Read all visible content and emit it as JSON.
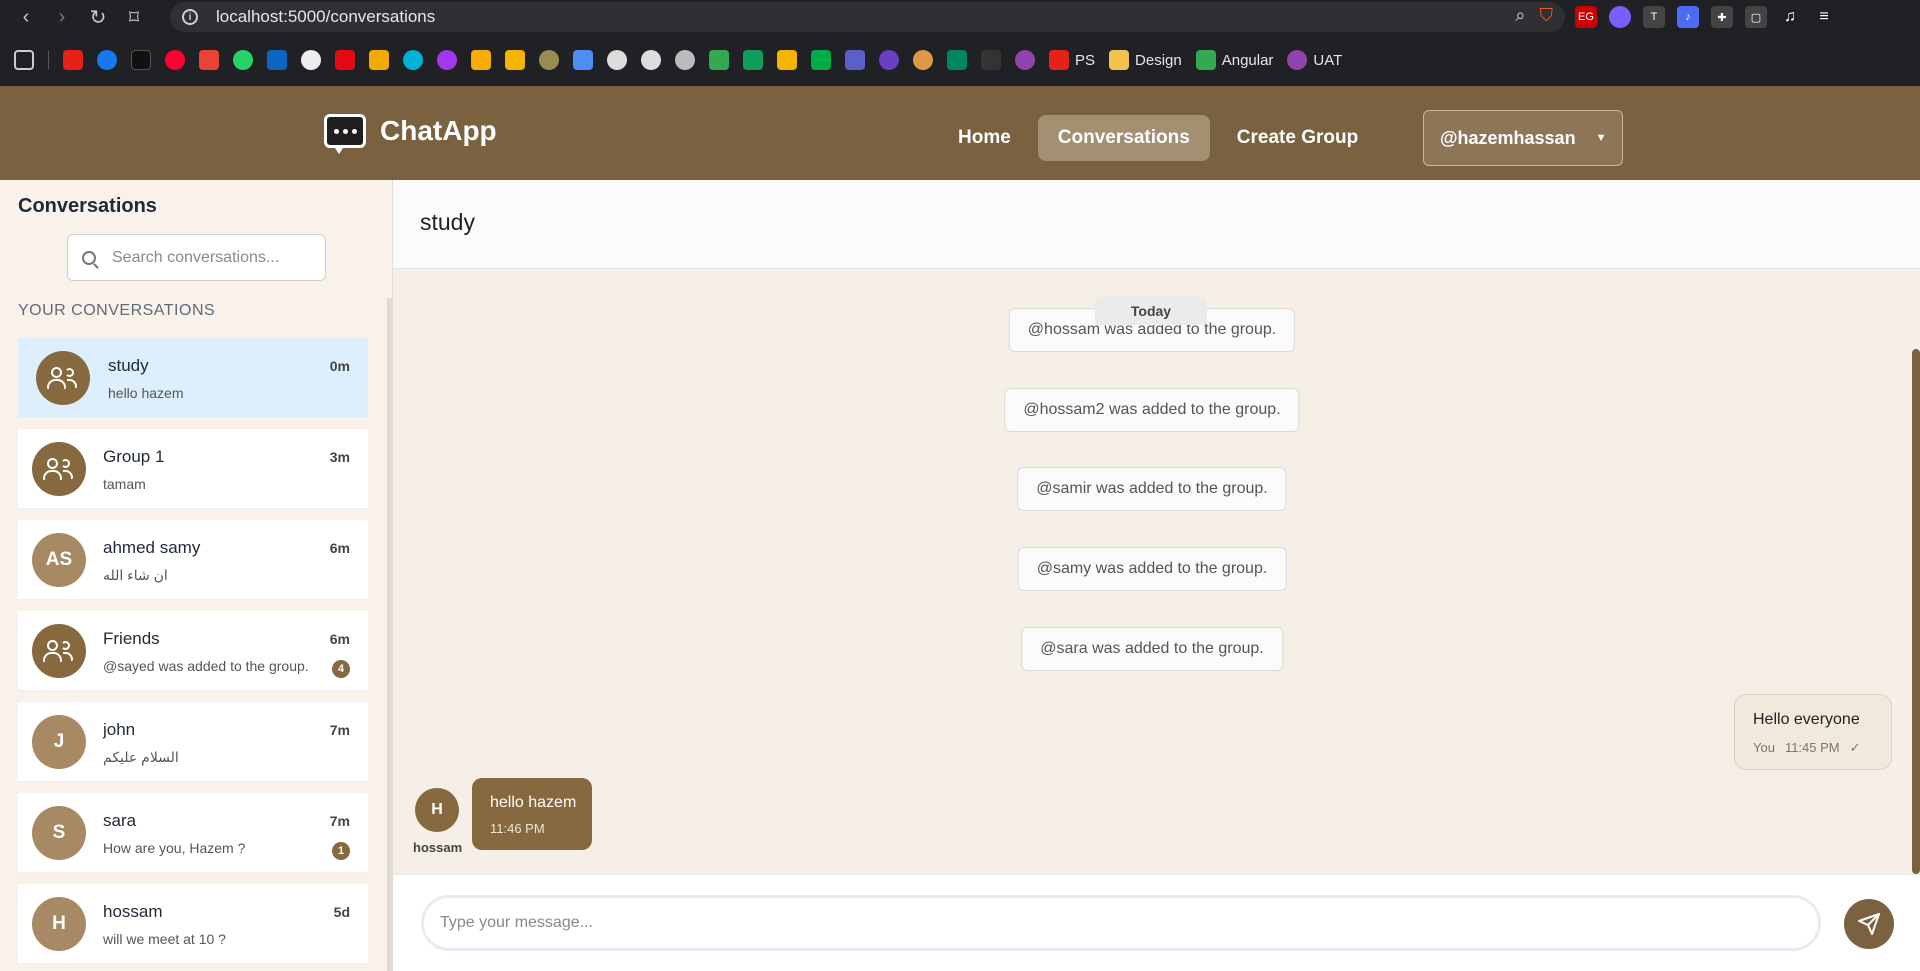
{
  "browser": {
    "url": "localhost:5000/conversations",
    "bookmarks": [
      {
        "label": "PS"
      },
      {
        "label": "Design"
      },
      {
        "label": "Angular"
      },
      {
        "label": "UAT"
      }
    ]
  },
  "header": {
    "brand": "ChatApp",
    "nav": {
      "home": "Home",
      "conversations": "Conversations",
      "create_group": "Create Group"
    },
    "user": "@hazemhassan"
  },
  "sidebar": {
    "title": "Conversations",
    "search_placeholder": "Search conversations...",
    "section_label": "YOUR CONVERSATIONS",
    "items": [
      {
        "name": "study",
        "preview": "hello hazem",
        "time": "0m",
        "avatar": "group",
        "unread": ""
      },
      {
        "name": "Group 1",
        "preview": "tamam",
        "time": "3m",
        "avatar": "group",
        "unread": ""
      },
      {
        "name": "ahmed samy",
        "preview": "ان شاء الله",
        "time": "6m",
        "avatar": "AS",
        "unread": ""
      },
      {
        "name": "Friends",
        "preview": "@sayed was added to the group.",
        "time": "6m",
        "avatar": "group",
        "unread": "4"
      },
      {
        "name": "john",
        "preview": "السلام عليكم",
        "time": "7m",
        "avatar": "J",
        "unread": ""
      },
      {
        "name": "sara",
        "preview": "How are you, Hazem ?",
        "time": "7m",
        "avatar": "S",
        "unread": "1"
      },
      {
        "name": "hossam",
        "preview": "will we meet at 10 ?",
        "time": "5d",
        "avatar": "H",
        "unread": ""
      }
    ]
  },
  "chat": {
    "title": "study",
    "date_separator": "Today",
    "system_messages": [
      "@hossam was added to the group.",
      "@hossam2 was added to the group.",
      "@samir was added to the group.",
      "@samy was added to the group.",
      "@sara was added to the group."
    ],
    "outgoing": {
      "text": "Hello everyone",
      "sender": "You",
      "time": "11:45 PM",
      "status": "✓"
    },
    "incoming": {
      "text": "hello hazem",
      "time": "11:46 PM",
      "sender": "hossam",
      "initial": "H"
    },
    "input_placeholder": "Type your message..."
  },
  "colors": {
    "brand": "#7a6240",
    "active_item": "#ddeffc",
    "bubble_in": "#86693f",
    "bubble_out": "#f1e9dc"
  }
}
